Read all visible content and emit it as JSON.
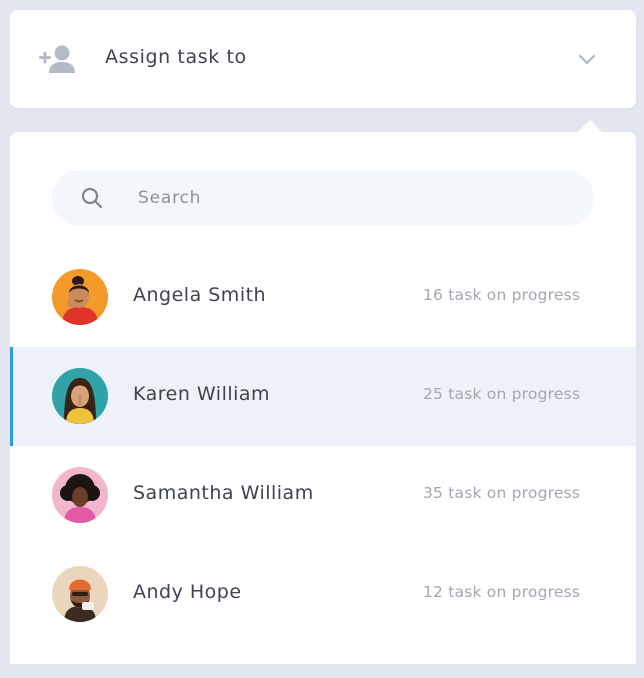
{
  "assign": {
    "label": "Assign task to",
    "icon": "add-user-icon",
    "dropdown_icon": "chevron-down-icon"
  },
  "search": {
    "placeholder": "Search",
    "value": "",
    "icon": "search-icon"
  },
  "users": [
    {
      "name": "Angela Smith",
      "progress": "16 task on progress",
      "avatar_bg": "#f39a2b",
      "selected": false
    },
    {
      "name": "Karen William",
      "progress": "25 task on progress",
      "avatar_bg": "#2fa3a8",
      "selected": true
    },
    {
      "name": "Samantha William",
      "progress": "35 task on progress",
      "avatar_bg": "#f2b6cc",
      "selected": false
    },
    {
      "name": "Andy Hope",
      "progress": "12 task on progress",
      "avatar_bg": "#e9d6bd",
      "selected": false
    }
  ],
  "colors": {
    "accent": "#2d9cdb",
    "selected_row": "#edf2fa",
    "icon_grey": "#b4bac6",
    "text": "#3f4350",
    "muted_text": "#a2a7b2"
  }
}
